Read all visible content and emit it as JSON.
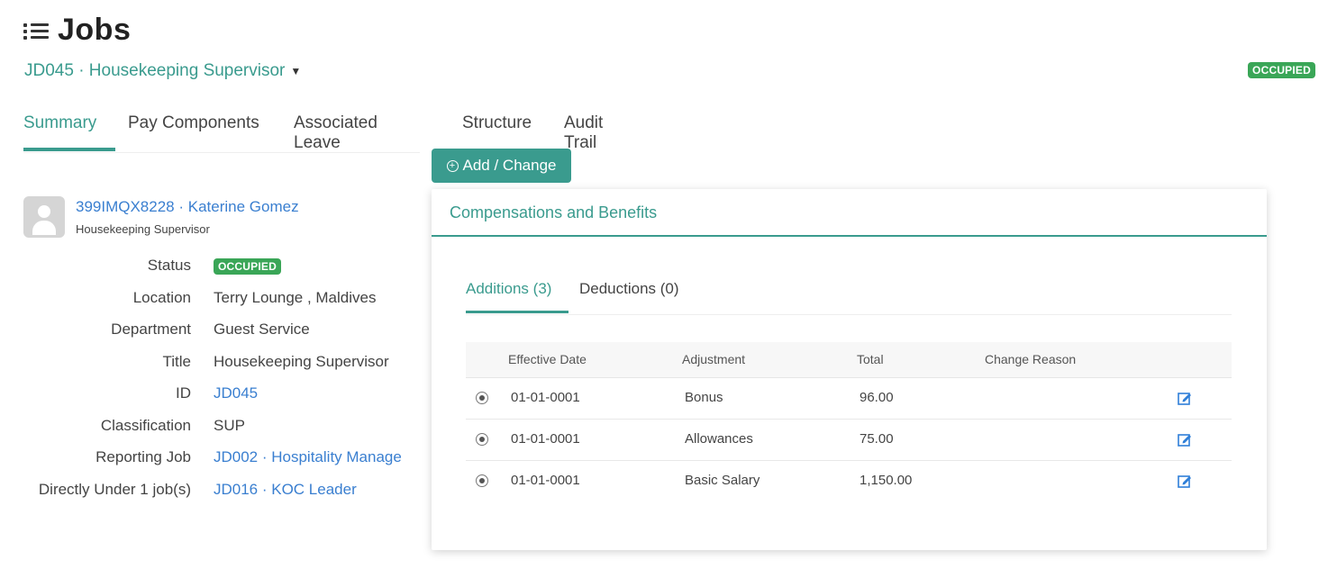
{
  "header": {
    "title": "Jobs",
    "job_selector": "JD045 · Housekeeping Supervisor",
    "status_badge": "OCCUPIED"
  },
  "tabs": [
    {
      "label": "Summary",
      "active": true
    },
    {
      "label": "Pay Components",
      "active": false
    },
    {
      "label": "Associated Leave",
      "active": false
    },
    {
      "label": "Structure",
      "active": false
    },
    {
      "label": "Audit Trail",
      "active": false
    }
  ],
  "employee": {
    "name": "399IMQX8228 · Katerine Gomez",
    "title": "Housekeeping Supervisor"
  },
  "details": [
    {
      "label": "Status",
      "value": "OCCUPIED",
      "type": "badge"
    },
    {
      "label": "Location",
      "value": "Terry Lounge , Maldives",
      "type": "text"
    },
    {
      "label": "Department",
      "value": "Guest Service",
      "type": "text"
    },
    {
      "label": "Title",
      "value": "Housekeeping Supervisor",
      "type": "text"
    },
    {
      "label": "ID",
      "value": "JD045",
      "type": "link"
    },
    {
      "label": "Classification",
      "value": "SUP",
      "type": "text"
    },
    {
      "label": "Reporting Job",
      "value": "JD002 · Hospitality Manage",
      "type": "link"
    },
    {
      "label": "Directly Under 1 job(s)",
      "value": "JD016 · KOC Leader",
      "type": "link"
    }
  ],
  "add_change_button": "Add / Change",
  "panel": {
    "title": "Compensations and Benefits",
    "subtabs": [
      {
        "label": "Additions (3)",
        "active": true
      },
      {
        "label": "Deductions (0)",
        "active": false
      }
    ],
    "columns": [
      "Effective Date",
      "Adjustment",
      "Total",
      "Change Reason"
    ],
    "rows": [
      {
        "date": "01-01-0001",
        "adjustment": "Bonus",
        "total": "96.00",
        "reason": ""
      },
      {
        "date": "01-01-0001",
        "adjustment": "Allowances",
        "total": "75.00",
        "reason": ""
      },
      {
        "date": "01-01-0001",
        "adjustment": "Basic Salary",
        "total": "1,150.00",
        "reason": ""
      }
    ]
  },
  "colors": {
    "accent": "#3a9b8e",
    "link": "#3a7fd0",
    "badge": "#3aa657"
  }
}
